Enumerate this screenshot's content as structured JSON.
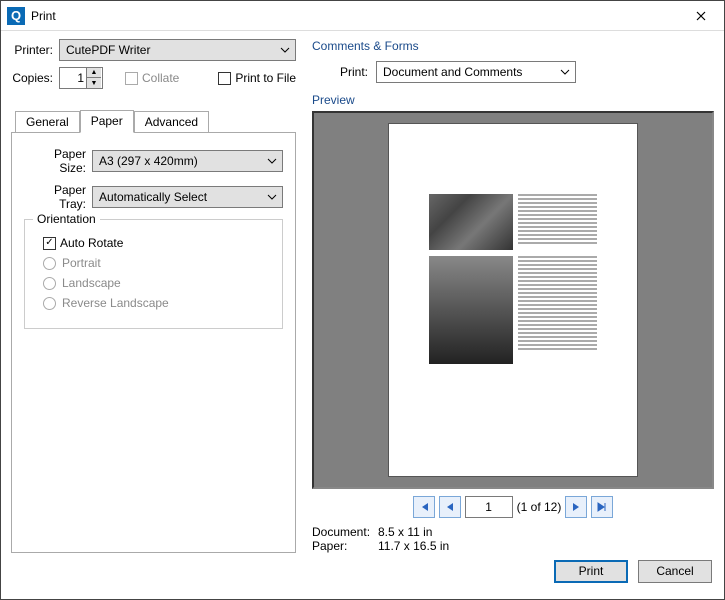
{
  "window": {
    "title": "Print"
  },
  "left": {
    "printer_label": "Printer:",
    "printer_value": "CutePDF Writer",
    "copies_label": "Copies:",
    "copies_value": "1",
    "collate_label": "Collate",
    "print_to_file_label": "Print to File",
    "tabs": {
      "general": "General",
      "paper": "Paper",
      "advanced": "Advanced"
    },
    "paper_size_label": "Paper Size:",
    "paper_size_value": "A3 (297 x 420mm)",
    "paper_tray_label": "Paper Tray:",
    "paper_tray_value": "Automatically Select",
    "orientation_legend": "Orientation",
    "auto_rotate_label": "Auto Rotate",
    "portrait_label": "Portrait",
    "landscape_label": "Landscape",
    "reverse_landscape_label": "Reverse Landscape"
  },
  "right": {
    "comments_forms_title": "Comments & Forms",
    "cf_print_label": "Print:",
    "cf_print_value": "Document and Comments",
    "preview_title": "Preview",
    "page_current": "1",
    "page_total_text": "(1 of 12)",
    "document_label": "Document:",
    "document_value": "8.5 x 11 in",
    "paper_label": "Paper:",
    "paper_value": "11.7 x 16.5 in"
  },
  "footer": {
    "print": "Print",
    "cancel": "Cancel"
  }
}
